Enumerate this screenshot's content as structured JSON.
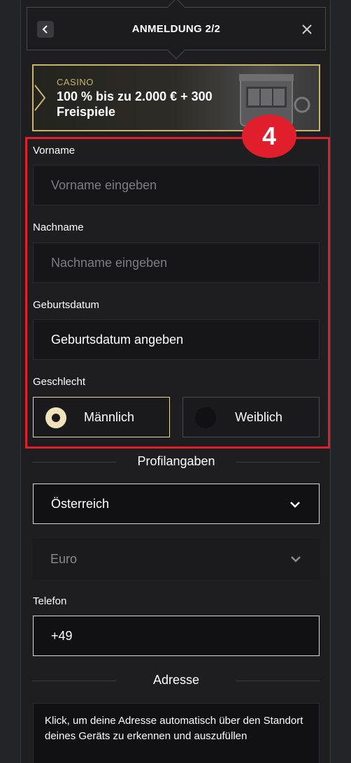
{
  "header": {
    "title": "ANMELDUNG 2/2"
  },
  "banner": {
    "category": "CASINO",
    "line1": "100 % bis zu 2.000 € + 300",
    "line2": "Freispiele"
  },
  "step_badge": "4",
  "form": {
    "first_name": {
      "label": "Vorname",
      "placeholder": "Vorname eingeben"
    },
    "last_name": {
      "label": "Nachname",
      "placeholder": "Nachname eingeben"
    },
    "birthdate": {
      "label": "Geburtsdatum",
      "value": "Geburtsdatum angeben"
    },
    "gender": {
      "label": "Geschlecht",
      "options": [
        {
          "label": "Männlich",
          "selected": true
        },
        {
          "label": "Weiblich",
          "selected": false
        }
      ]
    }
  },
  "profile": {
    "section_title": "Profilangaben",
    "country": "Österreich",
    "currency": "Euro",
    "phone": {
      "label": "Telefon",
      "value": "+49"
    }
  },
  "address": {
    "section_title": "Adresse",
    "autofill_text": "Klick, um deine Adresse automatisch über den Standort deines Geräts zu erkennen und auszufüllen"
  },
  "colors": {
    "accent_gold": "#c9b36d",
    "highlight_red": "#e01e2c",
    "selected_radio": "#f1e3b9"
  }
}
